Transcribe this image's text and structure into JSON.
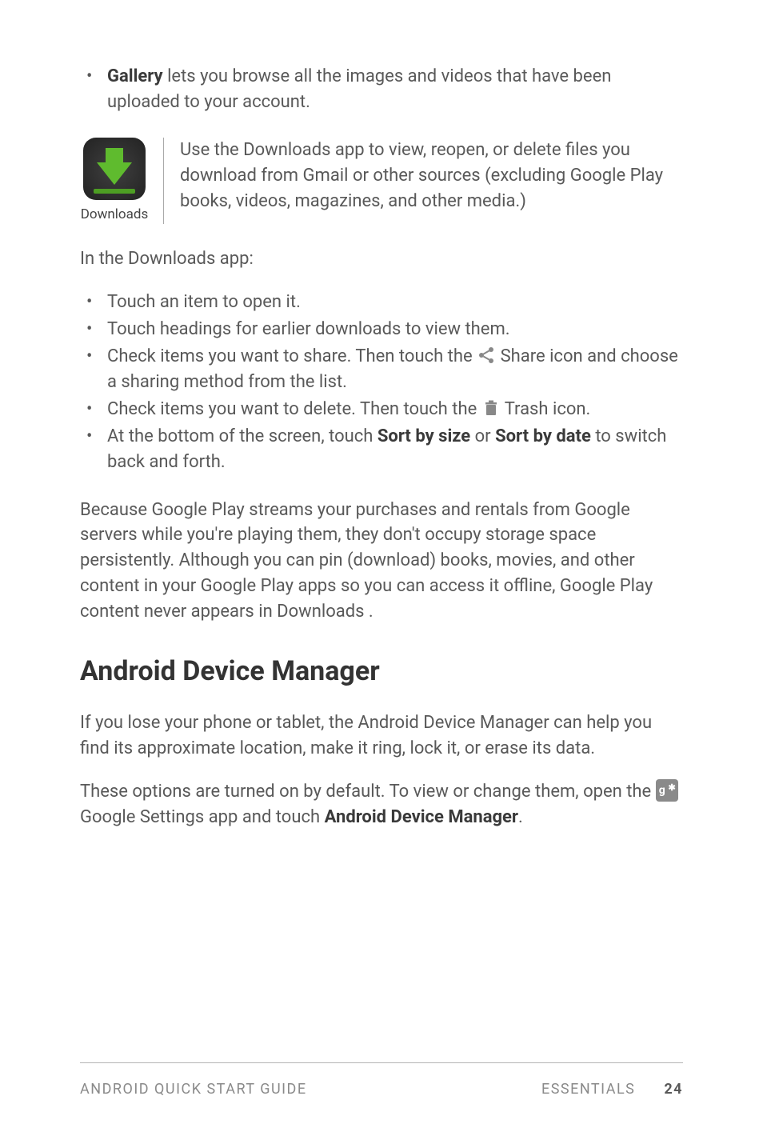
{
  "intro_bullet": {
    "strong": "Gallery",
    "rest": " lets you browse all the images and videos that have been uploaded to your account."
  },
  "callout": {
    "icon_label": "Downloads",
    "text": "Use the Downloads app to view, reopen, or delete files you download from Gmail or other sources (excluding Google Play books, videos, magazines, and other media.)"
  },
  "para1": "In the Downloads app:",
  "list2": {
    "item1": "Touch an item to open it.",
    "item2": "Touch headings for earlier downloads to view them.",
    "item3_a": "Check items you want to share. Then touch the ",
    "item3_b": " Share icon and choose a sharing method from the list.",
    "item4_a": "Check items you want to delete. Then touch the ",
    "item4_b": " Trash icon.",
    "item5_a": "At the bottom of the screen, touch ",
    "item5_strong1": "Sort by size",
    "item5_b": " or ",
    "item5_strong2": "Sort by date",
    "item5_c": " to switch back and forth."
  },
  "para2": "Because Google Play streams your purchases and rentals from Google servers while you're playing them, they don't occupy storage space persistently. Although you can pin (download) books, movies, and other content in your Google Play apps so you can access it offline, Google Play content never appears in Downloads .",
  "heading": "Android Device Manager",
  "para3": "If you lose your phone or tablet, the Android Device Manager can help you find its approximate location, make it ring, lock it, or erase its data.",
  "para4_a": "These options are turned on by default. To view or change them, open the ",
  "para4_b": " Google Settings app and touch ",
  "para4_strong": "Android Device Manager",
  "para4_c": ".",
  "footer": {
    "left": "ANDROID QUICK START GUIDE",
    "section": "ESSENTIALS",
    "page": "24"
  },
  "gs_icon_text": "g"
}
